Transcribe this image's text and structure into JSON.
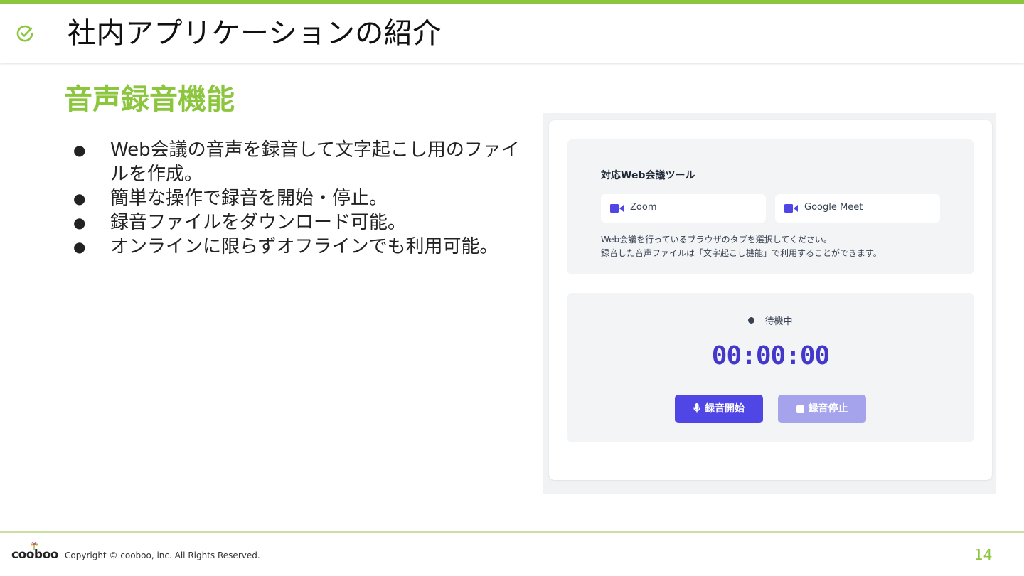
{
  "header": {
    "title": "社内アプリケーションの紹介",
    "icon": "check-circle-icon",
    "accent_color": "#8cc63f"
  },
  "section": {
    "title": "音声録音機能"
  },
  "bullets": [
    "Web会議の音声を録音して文字起こし用のファイルを作成。",
    "簡単な操作で録音を開始・停止。",
    "録音ファイルをダウンロード可能。",
    "オンラインに限らずオフラインでも利用可能。"
  ],
  "app": {
    "tools_title": "対応Web会議ツール",
    "tools": [
      {
        "label": "Zoom",
        "icon": "video-camera-icon"
      },
      {
        "label": "Google Meet",
        "icon": "video-camera-icon"
      }
    ],
    "description_line1": "Web会議を行っているブラウザのタブを選択してください。",
    "description_line2": "録音した音声ファイルは「文字起こし機能」で利用することができます。",
    "status": "待機中",
    "timer": "00:00:00",
    "start_button": "録音開始",
    "stop_button": "録音停止",
    "primary_color": "#4f46e5",
    "disabled_color": "#a5a3ec"
  },
  "footer": {
    "logo_text": "cooboo",
    "copyright": "Copyright © cooboo, inc. All Rights Reserved.",
    "page_number": "14"
  }
}
